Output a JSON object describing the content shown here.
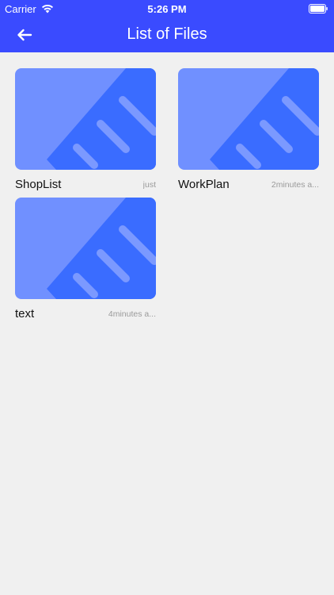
{
  "status": {
    "carrier": "Carrier",
    "time": "5:26 PM"
  },
  "nav": {
    "title": "List of Files"
  },
  "colors": {
    "header": "#3a4bff",
    "thumb_bg": "#7090ff",
    "thumb_fg": "#3a6cff",
    "thumb_stripe": "#7b99ff"
  },
  "files": [
    {
      "name": "ShopList",
      "time": "just"
    },
    {
      "name": "WorkPlan",
      "time": "2minutes a..."
    },
    {
      "name": "text",
      "time": "4minutes a..."
    }
  ]
}
